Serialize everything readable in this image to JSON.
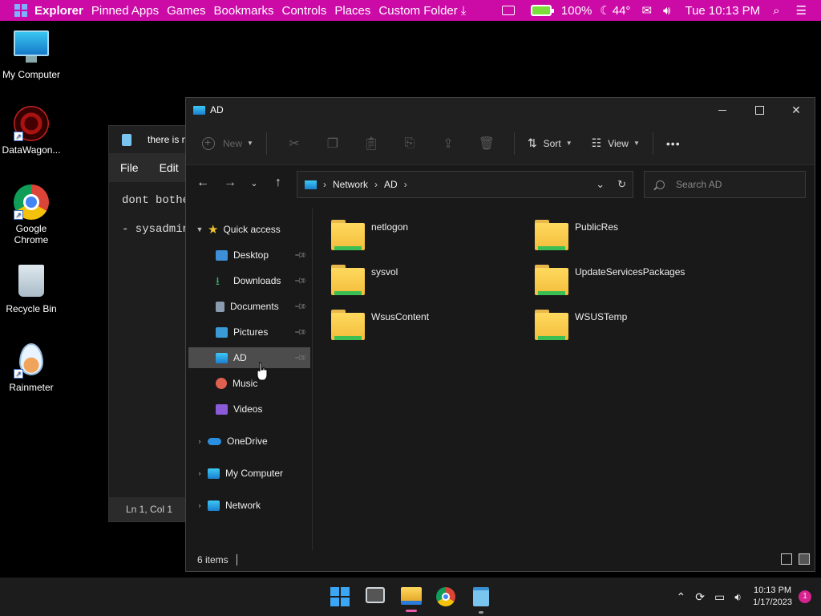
{
  "topbar": {
    "items": [
      "Explorer",
      "Pinned Apps",
      "Games",
      "Bookmarks",
      "Controls",
      "Places",
      "Custom Folder"
    ],
    "battery": "100%",
    "weather": "44°",
    "datetime": "Tue 10:13 PM",
    "accent": "#cc0aa6"
  },
  "desktop": {
    "icons": [
      {
        "label": "My Computer",
        "icon": "monitor-icon"
      },
      {
        "label": "DataWagon...",
        "icon": "datawagon-icon"
      },
      {
        "label": "Google Chrome",
        "icon": "chrome-icon"
      },
      {
        "label": "Recycle Bin",
        "icon": "recycle-bin-icon"
      },
      {
        "label": "Rainmeter",
        "icon": "rainmeter-icon"
      }
    ]
  },
  "notepad": {
    "title": "there is n",
    "menu": [
      "File",
      "Edit"
    ],
    "text": "dont bothe\n\n- sysadmin",
    "status": "Ln 1, Col 1"
  },
  "explorer": {
    "title": "AD",
    "toolbar": {
      "new_label": "New",
      "sort_label": "Sort",
      "view_label": "View",
      "more_label": "•••"
    },
    "address": {
      "crumbs": [
        "Network",
        "AD"
      ]
    },
    "search": {
      "placeholder": "Search AD"
    },
    "nav": {
      "quick_access": "Quick access",
      "items": [
        {
          "label": "Desktop",
          "color": "#3d8fd8"
        },
        {
          "label": "Downloads",
          "color": "#35b26b"
        },
        {
          "label": "Documents",
          "color": "#8a9bb0"
        },
        {
          "label": "Pictures",
          "color": "#3a9ad8"
        },
        {
          "label": "AD",
          "color": "#3cc8f5"
        },
        {
          "label": "Music",
          "color": "#e0604f"
        },
        {
          "label": "Videos",
          "color": "#8a5ad8"
        }
      ],
      "roots": [
        "OneDrive",
        "My Computer",
        "Network"
      ]
    },
    "folders": [
      "netlogon",
      "PublicRes",
      "sysvol",
      "UpdateServicesPackages",
      "WsusContent",
      "WSUSTemp"
    ],
    "status": "6 items"
  },
  "taskbar": {
    "time": "10:13 PM",
    "date": "1/17/2023",
    "notifications": "1"
  }
}
